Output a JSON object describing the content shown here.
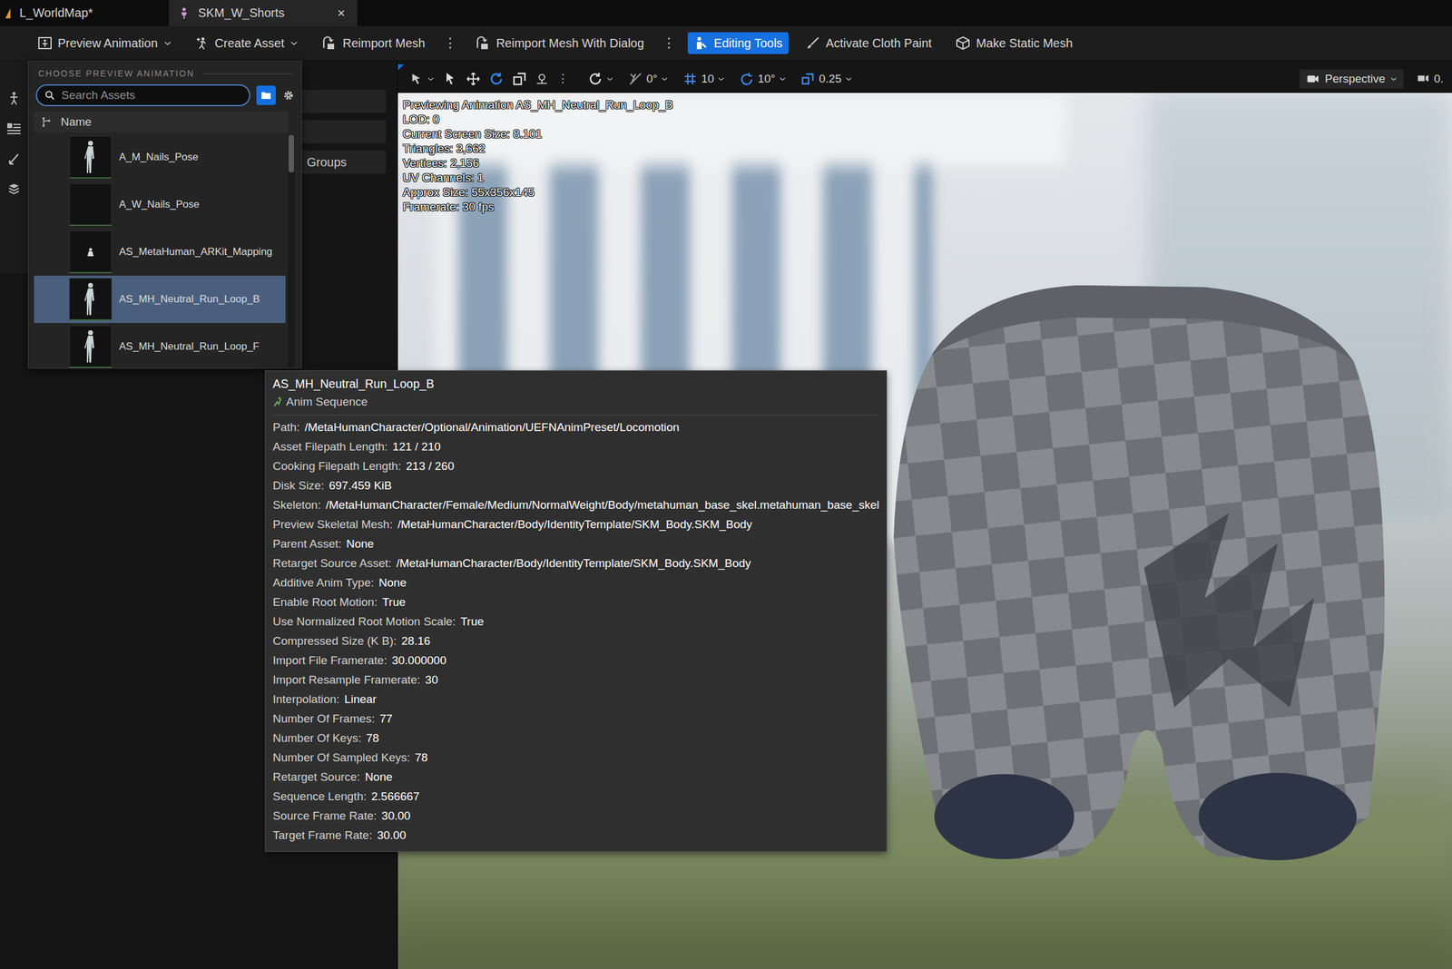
{
  "tabs": [
    {
      "label": "L_WorldMap*",
      "selected": false
    },
    {
      "label": "SKM_W_Shorts",
      "selected": true,
      "close": "×"
    }
  ],
  "toolbar": [
    {
      "label": "Preview Animation",
      "kind": "dropdown",
      "selected": false
    },
    {
      "label": "Create Asset",
      "kind": "dropdown",
      "selected": false
    },
    {
      "label": "Reimport Mesh",
      "kind": "button",
      "selected": false
    },
    {
      "label": "⋮",
      "kind": "more",
      "selected": false
    },
    {
      "label": "Reimport Mesh With Dialog",
      "kind": "button",
      "selected": false
    },
    {
      "label": "⋮",
      "kind": "more",
      "selected": false
    },
    {
      "label": "Editing Tools",
      "kind": "button",
      "selected": true
    },
    {
      "label": "Activate Cloth Paint",
      "kind": "button",
      "selected": false
    },
    {
      "label": "Make Static Mesh",
      "kind": "button",
      "selected": false
    }
  ],
  "left_panel": {
    "groups_button": "Groups"
  },
  "viewport_toolbar": {
    "more": "⋮",
    "transform_tools": [
      {
        "selected": false
      },
      {
        "selected": false
      },
      {
        "selected": true
      },
      {
        "selected": false
      }
    ],
    "snaps": [
      {
        "value": "0°",
        "on": false
      },
      {
        "value": "10",
        "on": true
      },
      {
        "value": "10°",
        "on": true
      },
      {
        "value": "0.25",
        "on": true
      }
    ],
    "view": "Perspective",
    "speed": "0."
  },
  "viewport_overlay": [
    "Previewing Animation AS_MH_Neutral_Run_Loop_B",
    "LOD: 0",
    "Current Screen Size: 8.101",
    "Triangles: 3,662",
    "Vertices: 2,156",
    "UV Channels: 1",
    "Approx Size: 55x356x145",
    "Framerate: 30 fps"
  ],
  "dropdown": {
    "heading": "CHOOSE PREVIEW ANIMATION",
    "search": {
      "placeholder": "Search Assets"
    },
    "column": "Name",
    "rows": [
      {
        "name": "A_M_Nails_Pose",
        "selected": false,
        "kind": "figure"
      },
      {
        "name": "A_W_Nails_Pose",
        "selected": false,
        "kind": "empty"
      },
      {
        "name": "AS_MetaHuman_ARKit_Mapping",
        "selected": false,
        "kind": "small"
      },
      {
        "name": "AS_MH_Neutral_Run_Loop_B",
        "selected": true,
        "kind": "figure"
      },
      {
        "name": "AS_MH_Neutral_Run_Loop_F",
        "selected": false,
        "kind": "figure"
      }
    ],
    "scrollbar": {
      "level": 0.16
    }
  },
  "tooltip": {
    "title": "AS_MH_Neutral_Run_Loop_B",
    "type": "Anim Sequence",
    "properties": [
      {
        "key": "Path:",
        "value": "/MetaHumanCharacter/Optional/Animation/UEFNAnimPreset/Locomotion"
      },
      {
        "key": "Asset Filepath Length:",
        "value": "121 / 210"
      },
      {
        "key": "Cooking Filepath Length:",
        "value": "213 / 260"
      },
      {
        "key": "Disk Size:",
        "value": "697.459 KiB"
      },
      {
        "key": "Skeleton:",
        "value": "/MetaHumanCharacter/Female/Medium/NormalWeight/Body/metahuman_base_skel.metahuman_base_skel"
      },
      {
        "key": "Preview Skeletal Mesh:",
        "value": "/MetaHumanCharacter/Body/IdentityTemplate/SKM_Body.SKM_Body"
      },
      {
        "key": "Parent Asset:",
        "value": "None"
      },
      {
        "key": "Retarget Source Asset:",
        "value": "/MetaHumanCharacter/Body/IdentityTemplate/SKM_Body.SKM_Body"
      },
      {
        "key": "Additive Anim Type:",
        "value": "None"
      },
      {
        "key": "Enable Root Motion:",
        "value": "True"
      },
      {
        "key": "Use Normalized Root Motion Scale:",
        "value": "True"
      },
      {
        "key": "Compressed Size (K B):",
        "value": "28.16"
      },
      {
        "key": "Import File Framerate:",
        "value": "30.000000"
      },
      {
        "key": "Import Resample Framerate:",
        "value": "30"
      },
      {
        "key": "Interpolation:",
        "value": "Linear"
      },
      {
        "key": "Number Of Frames:",
        "value": "77"
      },
      {
        "key": "Number Of Keys:",
        "value": "78"
      },
      {
        "key": "Number Of Sampled Keys:",
        "value": "78"
      },
      {
        "key": "Retarget Source:",
        "value": "None"
      },
      {
        "key": "Sequence Length:",
        "value": "2.566667"
      },
      {
        "key": "Source Frame Rate:",
        "value": "30.00"
      },
      {
        "key": "Target Frame Rate:",
        "value": "30.00"
      }
    ]
  }
}
